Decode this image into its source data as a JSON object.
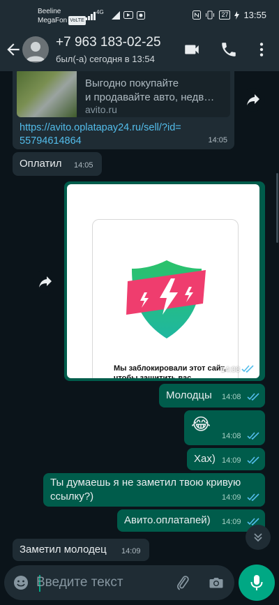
{
  "status_bar": {
    "carrier_1": "Beeline",
    "carrier_2": "MegaFon",
    "volte": "VoLTE",
    "network": "4G",
    "battery": "27",
    "time": "13:55"
  },
  "header": {
    "contact_name": "+7 963 183-02-25",
    "last_seen": "был(-а) сегодня в 13:54",
    "icons": [
      "back-arrow-icon",
      "avatar",
      "video-call-icon",
      "phone-icon",
      "more-vert-icon"
    ]
  },
  "messages": [
    {
      "direction": "in",
      "preview_title_1": "Выгодно покупайте",
      "preview_title_2": "и продавайте авто, недв…",
      "preview_domain": "avito.ru",
      "url_line_1": "https://avito.oplatapay24.ru/sell/?id=",
      "url_line_2": "55794614864",
      "time": "14:05"
    },
    {
      "direction": "in",
      "text": "Оплатил",
      "time": "14:05"
    },
    {
      "direction": "out",
      "image_caption": "Мы заблокировали этот сайт, чтобы защитить вас",
      "time": "14:08"
    },
    {
      "direction": "out",
      "text": "Молодцы",
      "time": "14:08"
    },
    {
      "direction": "out",
      "text": "😂",
      "time": "14:08"
    },
    {
      "direction": "out",
      "text": "Хах)",
      "time": "14:09"
    },
    {
      "direction": "out",
      "text_line_1": "Ты думаешь я не заметил твою кривую",
      "text_line_2": "ссылку?)",
      "time": "14:09"
    },
    {
      "direction": "out",
      "text": "Авито.оплатапей)",
      "time": "14:09"
    },
    {
      "direction": "in",
      "text": "Заметил молодец",
      "time": "14:09"
    }
  ],
  "input": {
    "placeholder": "Введите текст",
    "icons": [
      "emoji-icon",
      "attach-icon",
      "camera-icon",
      "mic-icon"
    ]
  },
  "colors": {
    "background": "#0b141a",
    "incoming_bubble": "#1f2c34",
    "outgoing_bubble": "#005c4b",
    "link": "#53bdeb",
    "accent": "#00a884",
    "read_ticks": "#53bdeb"
  }
}
